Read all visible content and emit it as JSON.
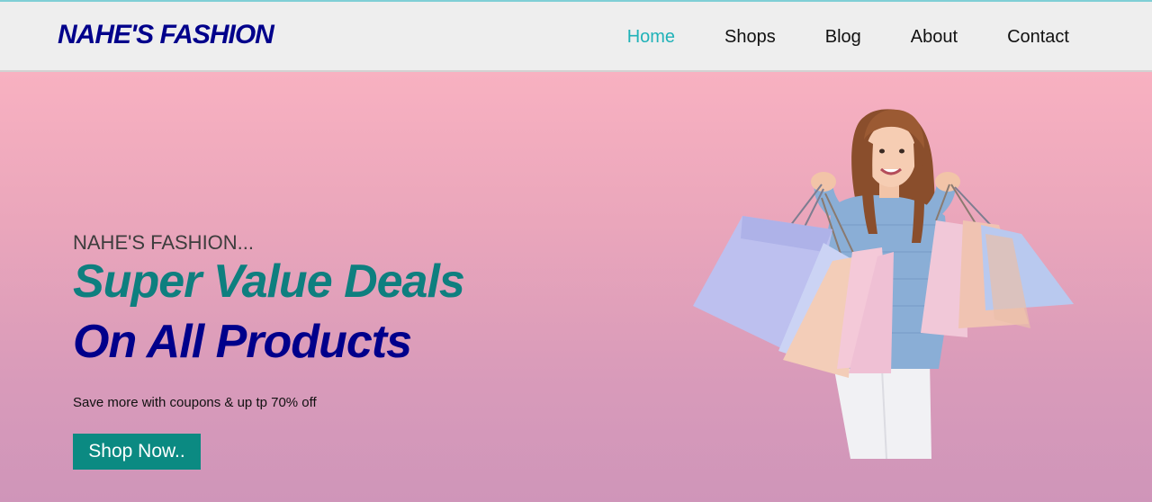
{
  "header": {
    "brand": "NAHE'S FASHION",
    "nav": {
      "home": "Home",
      "shops": "Shops",
      "blog": "Blog",
      "about": "About",
      "contact": "Contact"
    }
  },
  "hero": {
    "eyebrow": "NAHE'S FASHION...",
    "headline_line1": "Super Value Deals",
    "headline_line2": "On All Products",
    "subtext": "Save more with coupons & up tp 70% off",
    "cta_label": "Shop Now..",
    "image_icon": "woman-with-shopping-bags"
  },
  "colors": {
    "brand": "#00008b",
    "accent_teal": "#0e7f7f",
    "nav_active": "#20b2b8",
    "button_bg": "#0b8a82",
    "hero_top": "#f8b1c1",
    "hero_bottom": "#cf95b9"
  }
}
